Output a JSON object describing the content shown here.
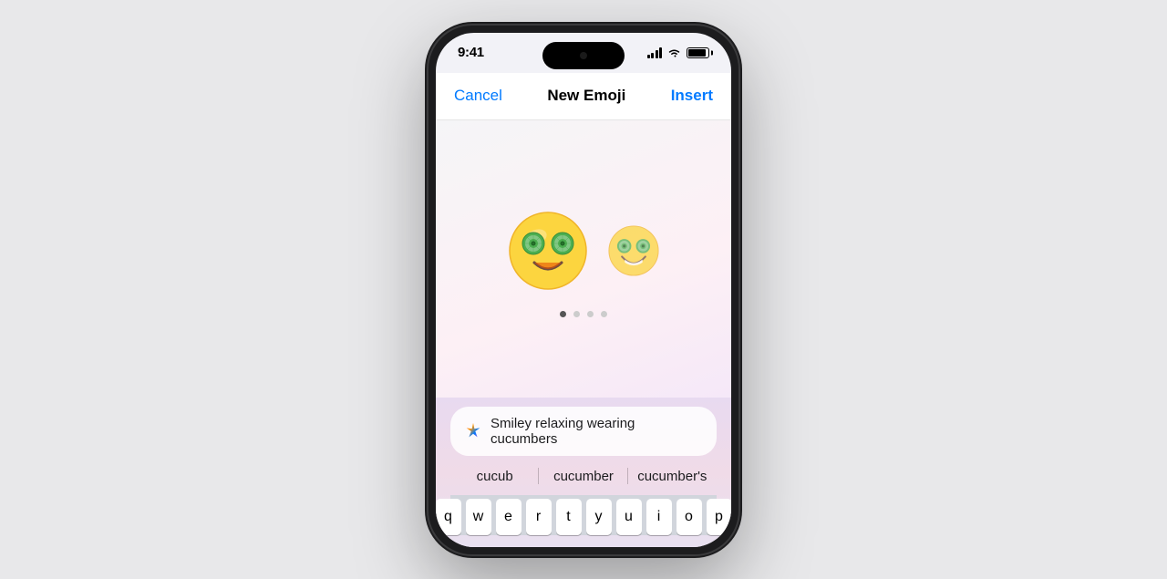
{
  "phone": {
    "status_bar": {
      "time": "9:41"
    }
  },
  "nav": {
    "cancel_label": "Cancel",
    "title": "New Emoji",
    "insert_label": "Insert"
  },
  "emoji_area": {
    "page_dots": [
      true,
      false,
      false,
      false
    ]
  },
  "input": {
    "placeholder": "Smiley relaxing wearing cucumbers",
    "ai_icon": "sparkle"
  },
  "autocomplete": {
    "items": [
      "cucub",
      "cucumber",
      "cucumber's"
    ]
  },
  "keyboard": {
    "rows": [
      [
        "q",
        "w",
        "e",
        "r",
        "t",
        "y",
        "u",
        "i",
        "o",
        "p"
      ]
    ]
  }
}
